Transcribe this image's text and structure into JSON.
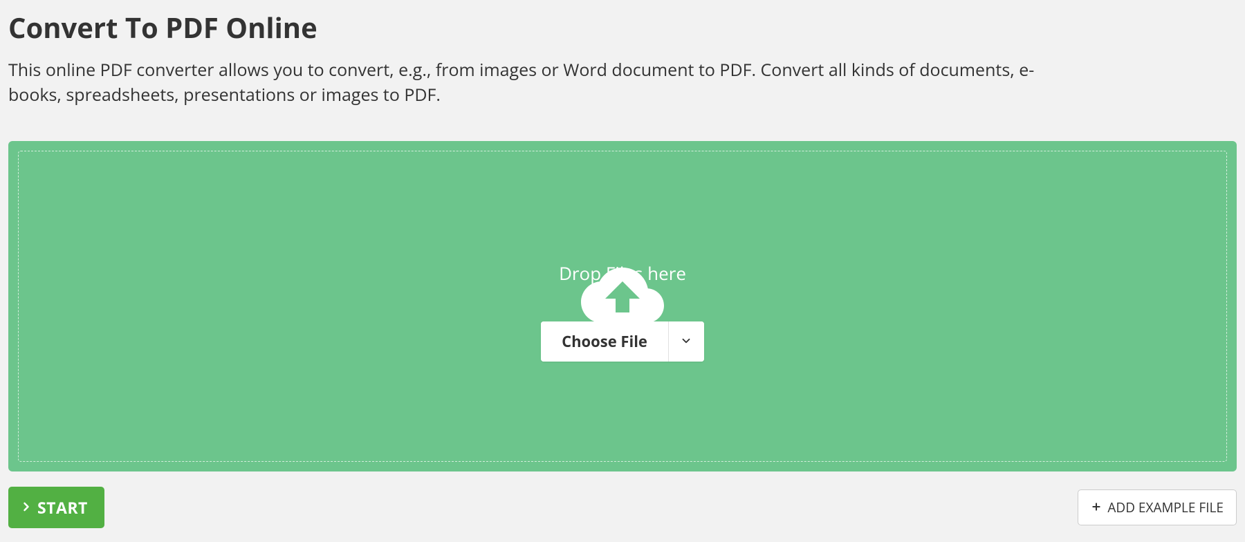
{
  "header": {
    "title": "Convert To PDF Online",
    "description": "This online PDF converter allows you to convert, e.g., from images or Word document to PDF. Convert all kinds of documents, e-books, spreadsheets, presentations or images to PDF."
  },
  "dropzone": {
    "drop_label": "Drop Files here",
    "choose_file_label": "Choose File"
  },
  "actions": {
    "start_label": "START",
    "add_example_label": "ADD EXAMPLE FILE"
  },
  "colors": {
    "dropzone_bg": "#6cc58c",
    "start_bg": "#52b043"
  }
}
